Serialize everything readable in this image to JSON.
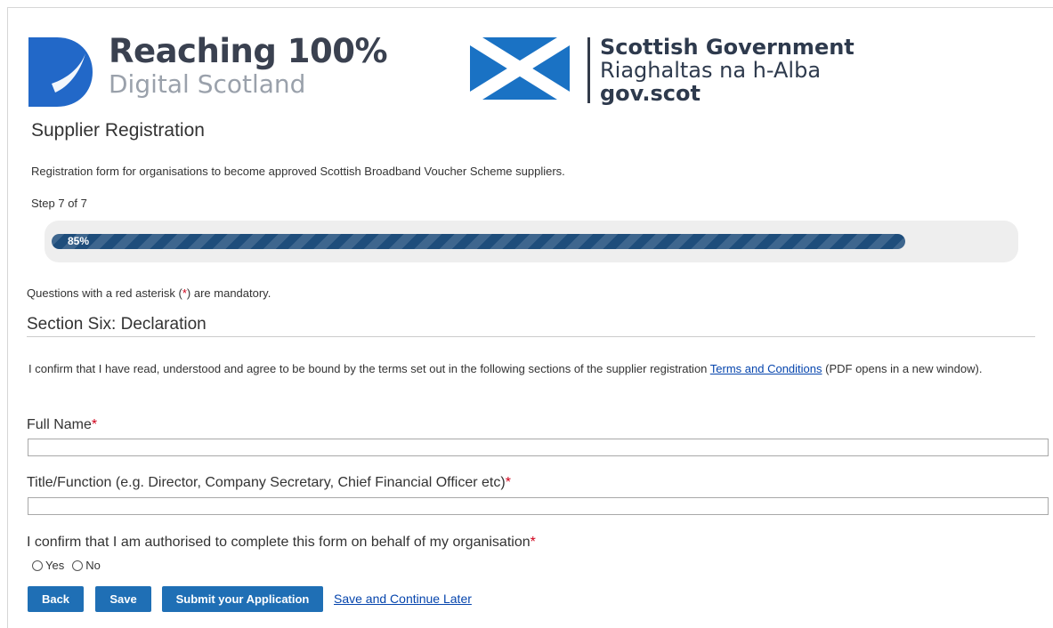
{
  "header": {
    "logo1_line1": "Reaching 100%",
    "logo1_line2": "Digital Scotland",
    "logo2_line1": "Scottish Government",
    "logo2_line2": "Riaghaltas na h-Alba",
    "logo2_line3": "gov.scot"
  },
  "page": {
    "title": "Supplier Registration",
    "intro": "Registration form for organisations to become approved Scottish Broadband Voucher Scheme suppliers.",
    "step": "Step 7 of 7"
  },
  "progress": {
    "label": "85%",
    "value": 0.89
  },
  "mandatory": {
    "prefix": "Questions with a red asterisk (",
    "asterisk": "*",
    "suffix": ") are mandatory."
  },
  "section": {
    "heading": "Section Six: Declaration",
    "confirm_prefix": "I confirm that I have read, understood and agree to be bound by the terms set out in the following sections of the supplier registration ",
    "confirm_link": "Terms and Conditions",
    "confirm_suffix": " (PDF opens in a new window)."
  },
  "fields": {
    "full_name_label": "Full Name",
    "full_name_value": "",
    "title_label": "Title/Function (e.g. Director, Company Secretary, Chief Financial Officer etc)",
    "title_value": "",
    "authorised_label": "I confirm that I am authorised to complete this form on behalf of my organisation",
    "asterisk": "*",
    "radio_yes": "Yes",
    "radio_no": "No"
  },
  "actions": {
    "back": "Back",
    "save": "Save",
    "submit": "Submit your Application",
    "save_later": "Save and Continue Later"
  },
  "colors": {
    "button": "#1f6fb5",
    "progress": "#1e4d7b",
    "asterisk": "#d0021b",
    "link": "#0645ad",
    "logo_blue": "#2268c8"
  }
}
